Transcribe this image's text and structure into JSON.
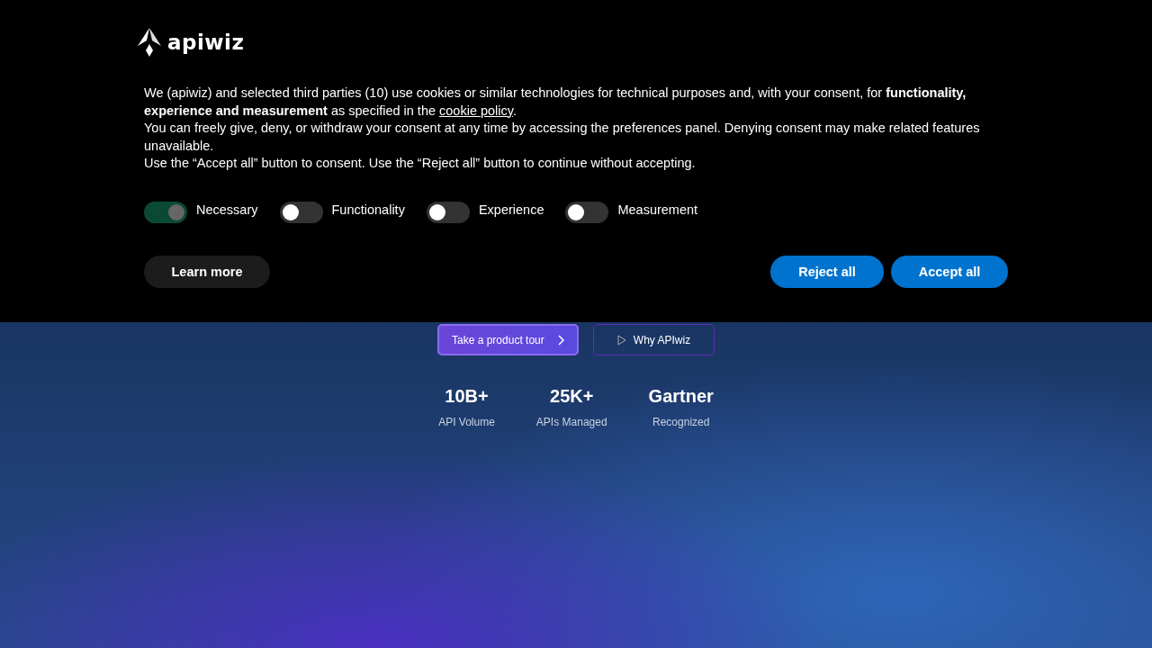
{
  "banner": {
    "logo": "apiwiz",
    "paragraphs": [
      {
        "before": "We (apiwiz) and selected third parties (10) use cookies or similar technologies for technical purposes and, with your consent, for **functionality, experience and measurement** as specified in the ",
        "link": "cookie policy",
        "after": "."
      },
      {
        "before": "You can freely give, deny, or withdraw your consent at any time by accessing the preferences panel. Denying consent may make related features unavailable."
      },
      {
        "before": "Use the “Accept all” button to consent. Use the “Reject all” button to continue without accepting."
      }
    ],
    "toggles": [
      {
        "label": "Necessary",
        "checked": true,
        "disabled": true
      },
      {
        "label": "Functionality",
        "checked": false,
        "disabled": false
      },
      {
        "label": "Experience",
        "checked": false,
        "disabled": false
      },
      {
        "label": "Measurement",
        "checked": false,
        "disabled": false
      }
    ],
    "learn_more": "Learn more",
    "reject": "Reject all",
    "accept": "Accept all"
  },
  "hero": {
    "buttons": [
      {
        "label": "Take a product tour",
        "kind": "primary"
      },
      {
        "label": "Why APIwiz",
        "kind": "outline"
      }
    ],
    "stats": [
      {
        "value": "10B+",
        "label": "API Volume"
      },
      {
        "value": "25K+",
        "label": "APIs Managed"
      },
      {
        "value": "Gartner",
        "label": "Recognized"
      }
    ]
  }
}
